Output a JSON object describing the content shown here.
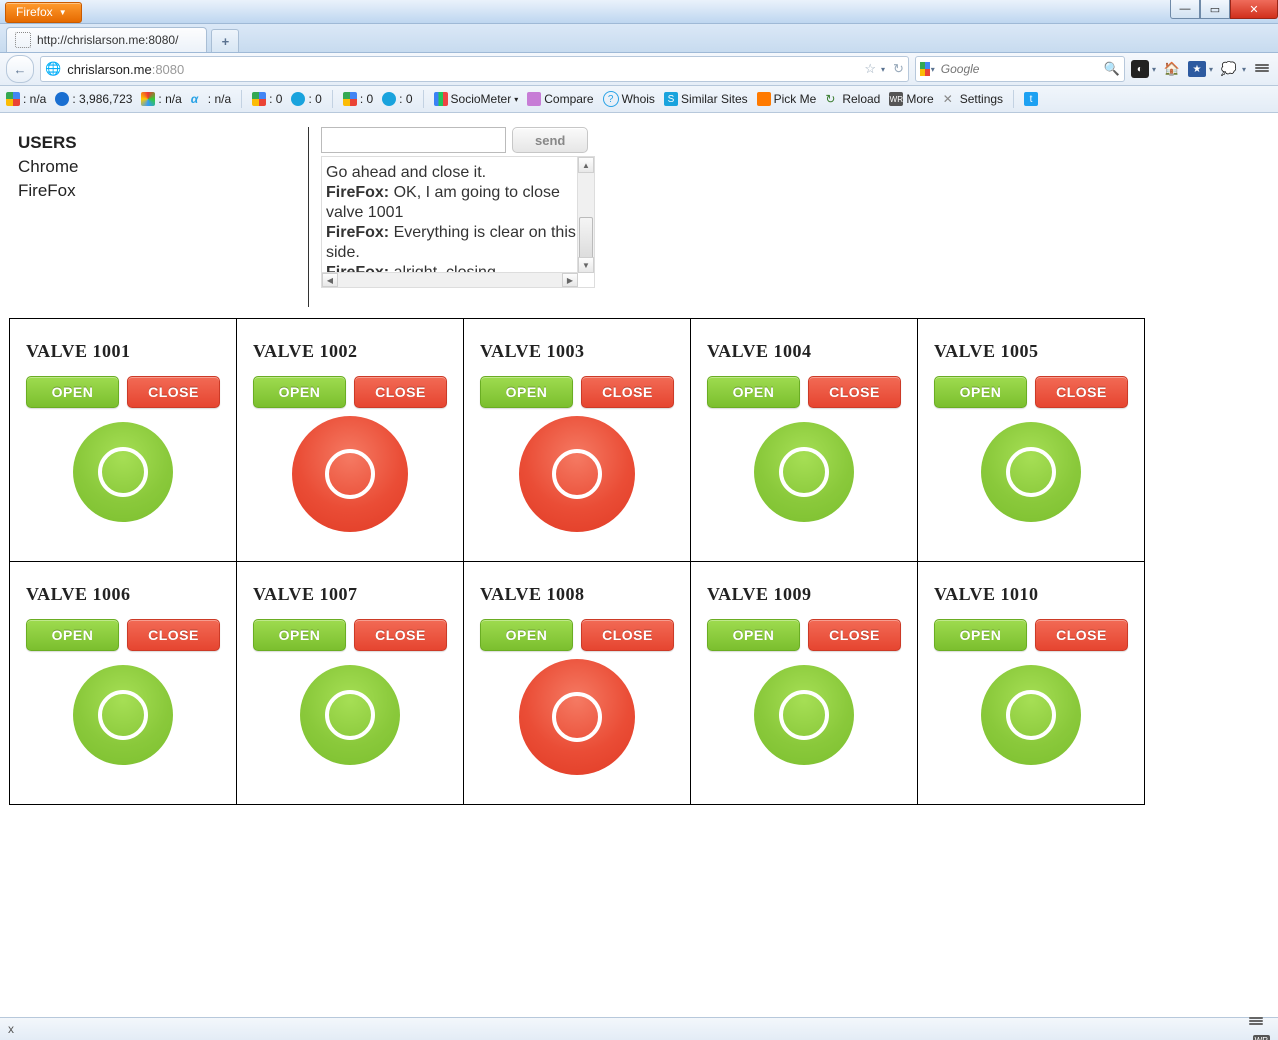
{
  "browser": {
    "menu_label": "Firefox",
    "tab_title": "http://chrislarson.me:8080/",
    "url_host": "chrislarson.me",
    "url_port": ":8080",
    "search_placeholder": "Google"
  },
  "bookmarks": [
    {
      "label": ": n/a"
    },
    {
      "label": ": 3,986,723"
    },
    {
      "label": ": n/a"
    },
    {
      "label": ": n/a"
    },
    {
      "label": ": 0"
    },
    {
      "label": ": 0"
    },
    {
      "label": ": 0"
    },
    {
      "label": ": 0"
    },
    {
      "label": "SocioMeter"
    },
    {
      "label": "Compare"
    },
    {
      "label": "Whois"
    },
    {
      "label": "Similar Sites"
    },
    {
      "label": "Pick Me"
    },
    {
      "label": "Reload"
    },
    {
      "label": "More"
    },
    {
      "label": "Settings"
    }
  ],
  "users": {
    "heading": "USERS",
    "list": [
      "Chrome",
      "FireFox"
    ]
  },
  "chat": {
    "send_label": "send",
    "messages": [
      {
        "author": "",
        "text": "Go ahead and close it."
      },
      {
        "author": "FireFox:",
        "text": " OK, I am going to close valve 1001"
      },
      {
        "author": "FireFox:",
        "text": " Everything is clear on this side."
      },
      {
        "author": "FireFox:",
        "text": " alright, closing"
      }
    ]
  },
  "buttons": {
    "open": "OPEN",
    "close": "CLOSE"
  },
  "valves": [
    {
      "name": "VALVE 1001",
      "state": "green"
    },
    {
      "name": "VALVE 1002",
      "state": "red"
    },
    {
      "name": "VALVE 1003",
      "state": "red"
    },
    {
      "name": "VALVE 1004",
      "state": "green"
    },
    {
      "name": "VALVE 1005",
      "state": "green"
    },
    {
      "name": "VALVE 1006",
      "state": "green"
    },
    {
      "name": "VALVE 1007",
      "state": "green"
    },
    {
      "name": "VALVE 1008",
      "state": "red"
    },
    {
      "name": "VALVE 1009",
      "state": "green"
    },
    {
      "name": "VALVE 1010",
      "state": "green"
    }
  ],
  "statusbar": {
    "left": "x"
  }
}
